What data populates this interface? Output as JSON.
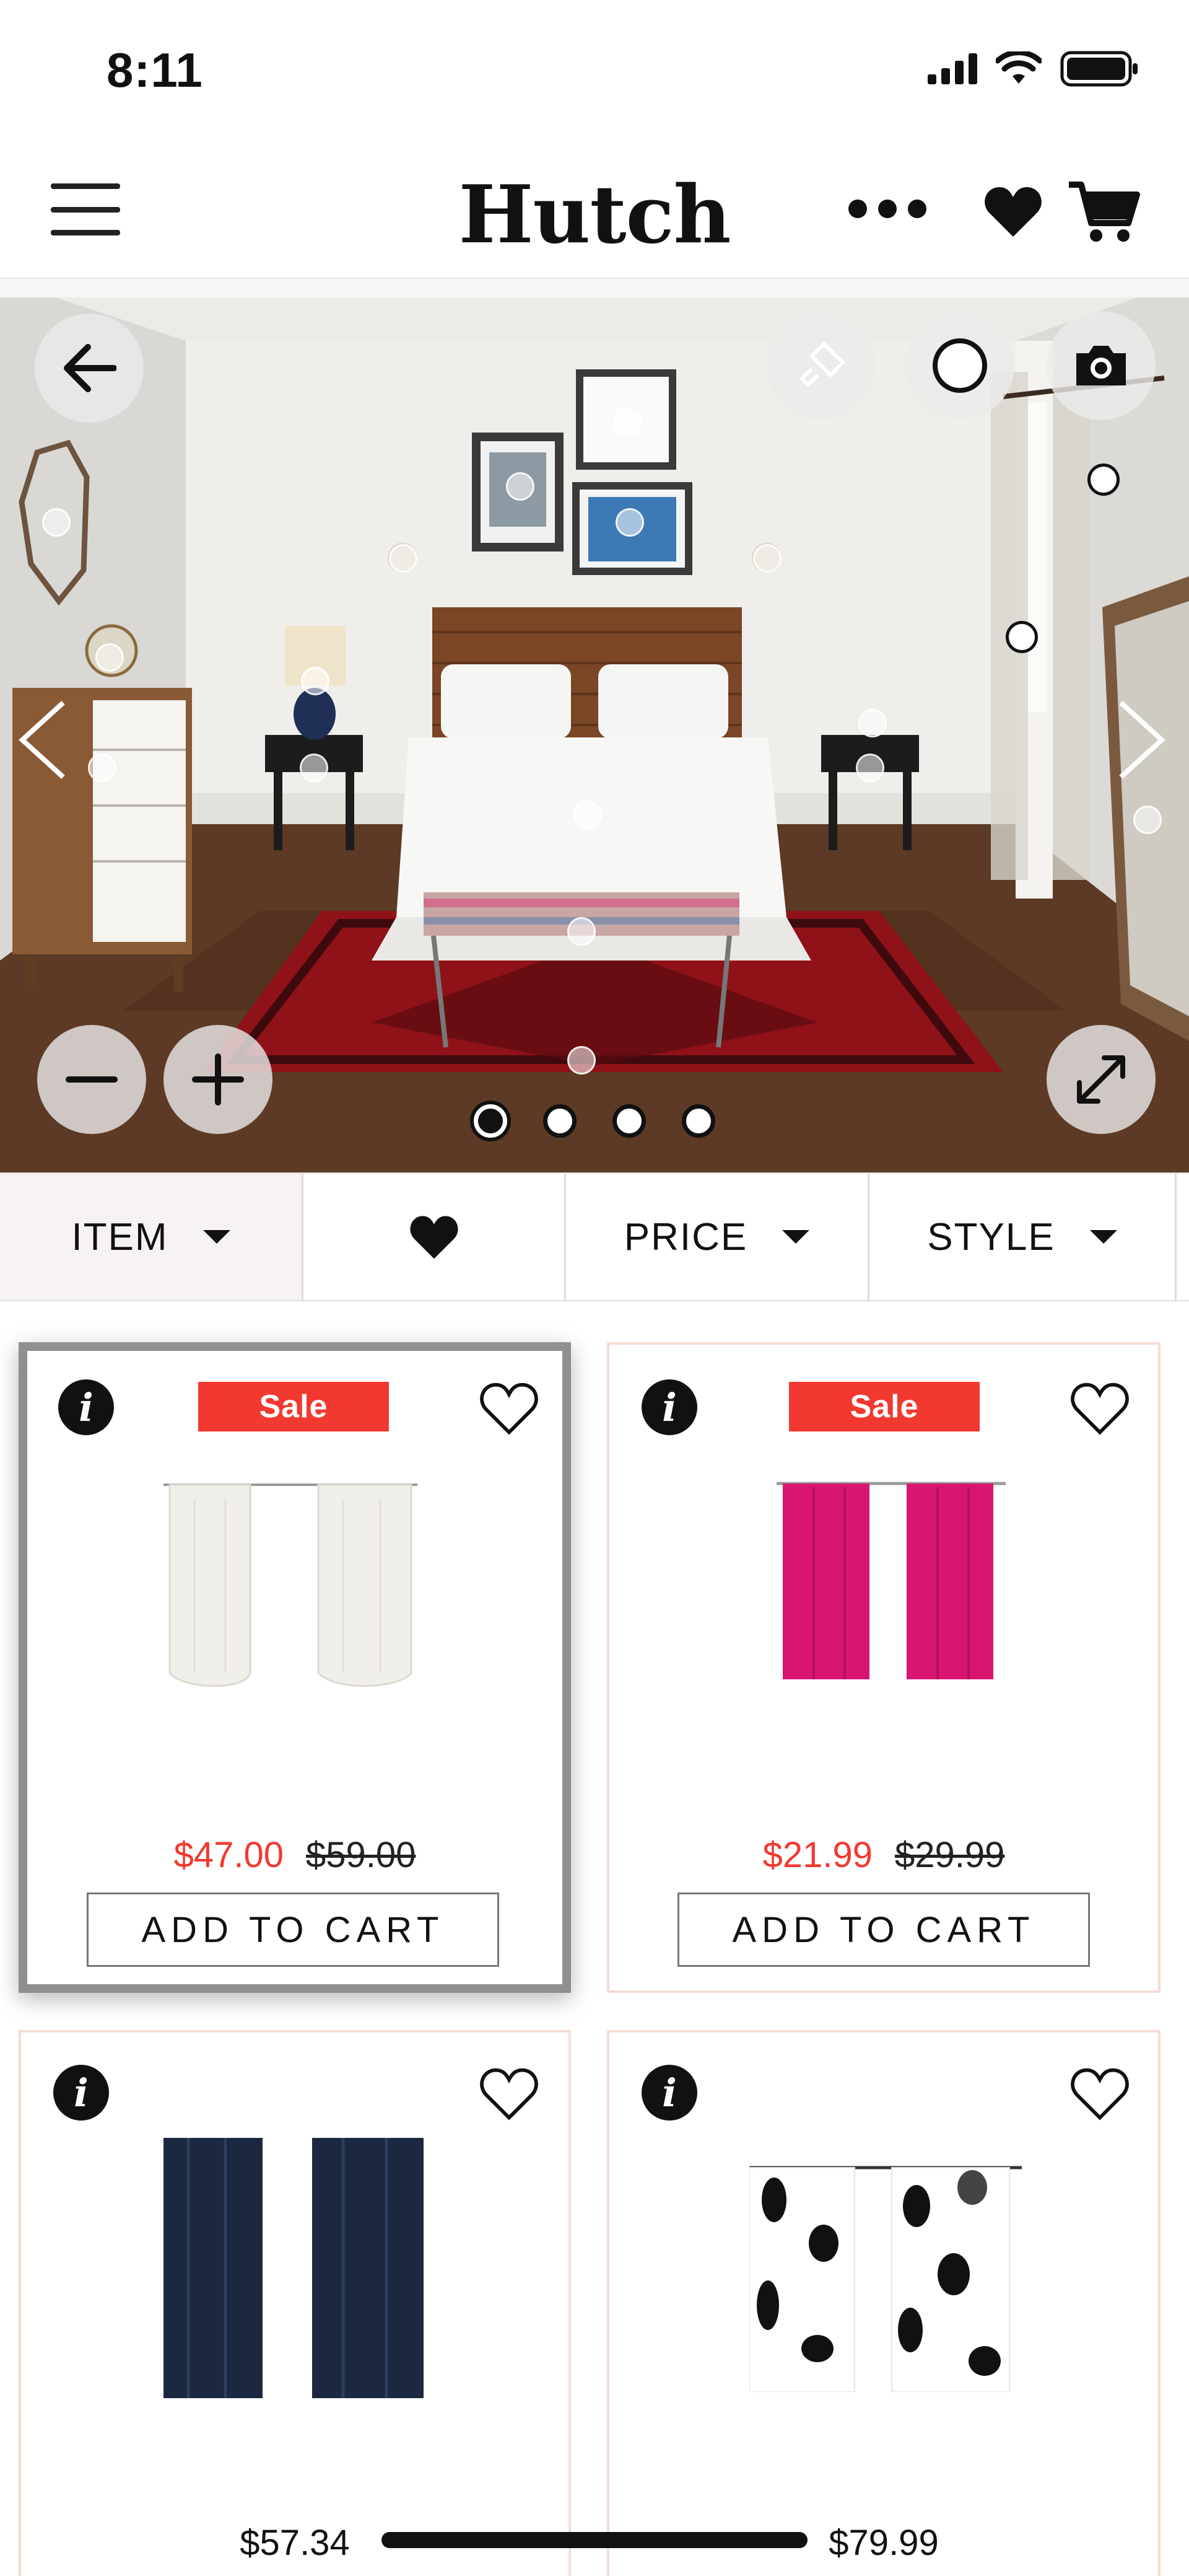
{
  "status_bar": {
    "time": "8:11"
  },
  "header": {
    "brand": "Hutch",
    "icons": [
      "menu-icon",
      "more-icon",
      "heart-icon",
      "cart-icon"
    ]
  },
  "scene": {
    "description_icons": [
      "back-arrow-icon",
      "paint-brush-icon",
      "circle-outline-icon",
      "camera-icon",
      "zoom-out-icon",
      "zoom-in-icon",
      "expand-icon",
      "previous-arrow-icon",
      "next-arrow-icon"
    ],
    "page_dots": 4,
    "active_dot": 0
  },
  "filters": {
    "item_label": "ITEM",
    "price_label": "PRICE",
    "style_label": "STYLE"
  },
  "products": [
    {
      "sale_badge": "Sale",
      "price": "$47.00",
      "old_price": "$59.00",
      "button": "ADD TO CART",
      "colors": {
        "curtain": "#f1efe9"
      }
    },
    {
      "sale_badge": "Sale",
      "price": "$21.99",
      "old_price": "$29.99",
      "button": "ADD TO CART",
      "colors": {
        "curtain": "#d9166f"
      }
    },
    {
      "price": "$57.34",
      "colors": {
        "curtain": "#1c2740"
      }
    },
    {
      "price": "$79.99",
      "colors": {
        "curtain": "#ffffff"
      }
    }
  ],
  "colors": {
    "sale_red": "#f2392f",
    "card_border": "#f5dcd3",
    "selected_border": "#8f8f8f"
  }
}
